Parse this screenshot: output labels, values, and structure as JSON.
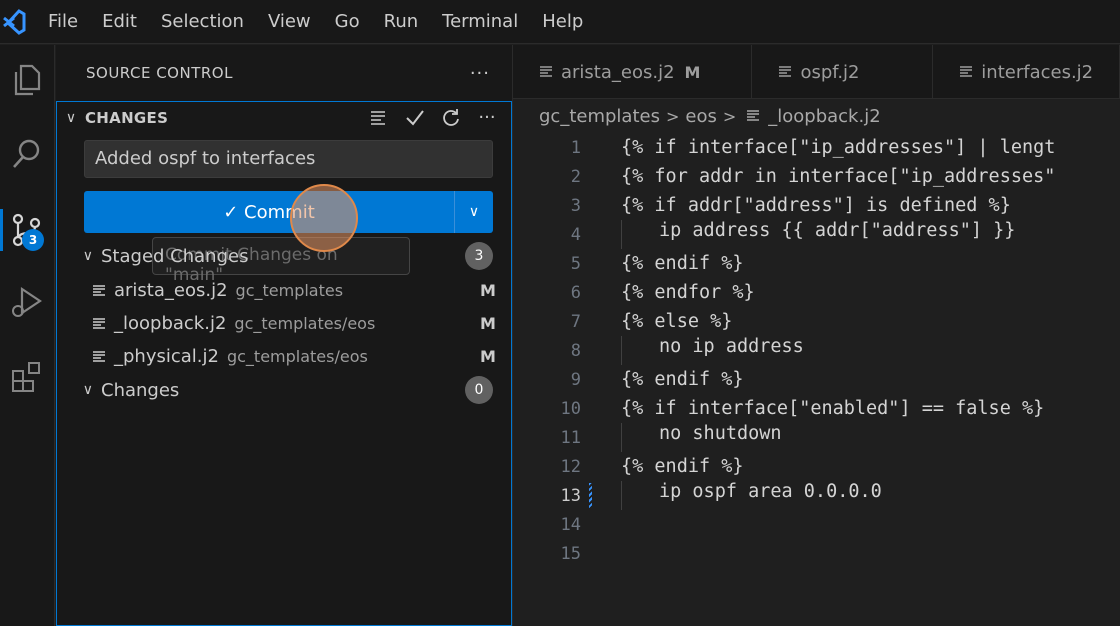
{
  "menu": [
    "File",
    "Edit",
    "Selection",
    "View",
    "Go",
    "Run",
    "Terminal",
    "Help"
  ],
  "activity": {
    "scm_badge": "3"
  },
  "sidebar": {
    "title": "SOURCE CONTROL",
    "section": "CHANGES",
    "commit_message": "Added ospf to interfaces",
    "commit_label": "✓ Commit",
    "tooltip": "Commit Changes on \"main\"",
    "staged": {
      "label": "Staged Changes",
      "count": "3",
      "files": [
        {
          "name": "arista_eos.j2",
          "path": "gc_templates",
          "status": "M"
        },
        {
          "name": "_loopback.j2",
          "path": "gc_templates/eos",
          "status": "M"
        },
        {
          "name": "_physical.j2",
          "path": "gc_templates/eos",
          "status": "M"
        }
      ]
    },
    "changes": {
      "label": "Changes",
      "count": "0"
    }
  },
  "editor": {
    "tabs": [
      {
        "label": "arista_eos.j2",
        "status": "M"
      },
      {
        "label": "ospf.j2",
        "status": ""
      },
      {
        "label": "interfaces.j2",
        "status": ""
      }
    ],
    "breadcrumb": [
      "gc_templates",
      "eos",
      "_loopback.j2"
    ],
    "current_line": 13,
    "lines": [
      "{% if interface[\"ip_addresses\"] | lengt",
      "{% for addr in interface[\"ip_addresses\"",
      "{% if addr[\"address\"] is defined %}",
      "ip address {{ addr[\"address\"] }}",
      "{% endif %}",
      "{% endfor %}",
      "{% else %}",
      "no ip address",
      "{% endif %}",
      "{% if interface[\"enabled\"] == false %}",
      "no shutdown",
      "{% endif %}",
      "ip ospf area 0.0.0.0",
      "",
      ""
    ],
    "indented_lines": [
      4,
      8,
      11,
      13
    ]
  },
  "colors": {
    "accent": "#0078d4",
    "background": "#1f1f1f",
    "sidebar": "#181818"
  }
}
